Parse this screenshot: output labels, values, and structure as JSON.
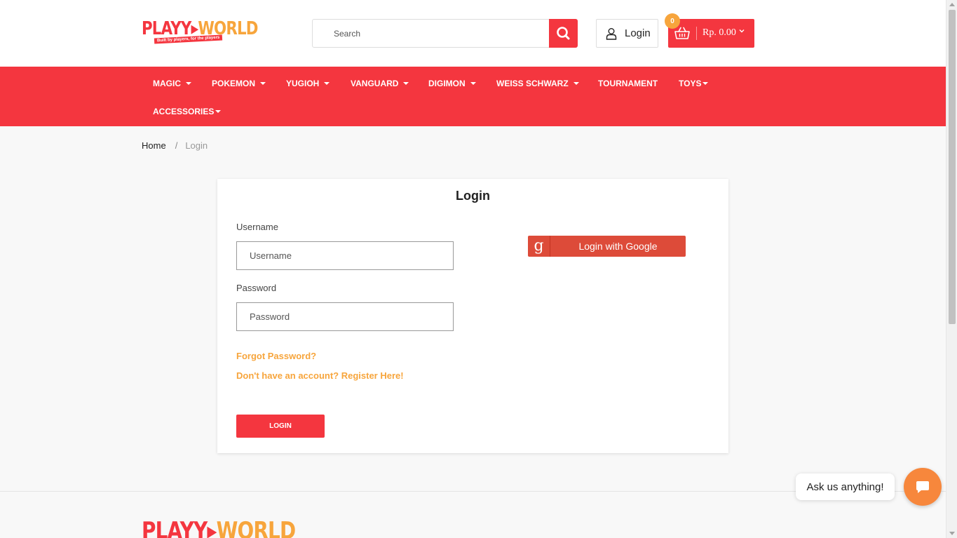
{
  "header": {
    "logo": {
      "word1": "PLAYY",
      "word2": "WORLD",
      "tagline": "Built by players, for the players"
    },
    "search": {
      "placeholder": "Search"
    },
    "login_label": "Login",
    "cart": {
      "count": "0",
      "amount": "Rp. 0.00"
    }
  },
  "nav": {
    "items": [
      {
        "label": "MAGIC",
        "dropdown": true
      },
      {
        "label": "POKEMON",
        "dropdown": true
      },
      {
        "label": "YUGIOH",
        "dropdown": true
      },
      {
        "label": "VANGUARD",
        "dropdown": true
      },
      {
        "label": "DIGIMON",
        "dropdown": true
      },
      {
        "label": "WEISS SCHWARZ",
        "dropdown": true
      },
      {
        "label": "TOURNAMENT",
        "dropdown": false
      },
      {
        "label": "TOYS",
        "dropdown": true
      },
      {
        "label": "ACCESSORIES",
        "dropdown": true
      }
    ]
  },
  "breadcrumb": {
    "home": "Home",
    "separator": "/",
    "current": "Login"
  },
  "login_form": {
    "title": "Login",
    "username_label": "Username",
    "username_placeholder": "Username",
    "password_label": "Password",
    "password_placeholder": "Password",
    "forgot_link": "Forgot Password?",
    "register_link": "Don't have an account? Register Here!",
    "submit_label": "LOGIN",
    "google_icon": "g",
    "google_label": "Login with Google"
  },
  "footer": {
    "logo_word1": "PLAYY",
    "logo_word2": "WORLD"
  },
  "chat": {
    "prompt": "Ask us anything!"
  },
  "colors": {
    "primary": "#f4363f",
    "accent": "#f7a53c",
    "google": "#dd4b39",
    "chat": "#f7873c"
  }
}
